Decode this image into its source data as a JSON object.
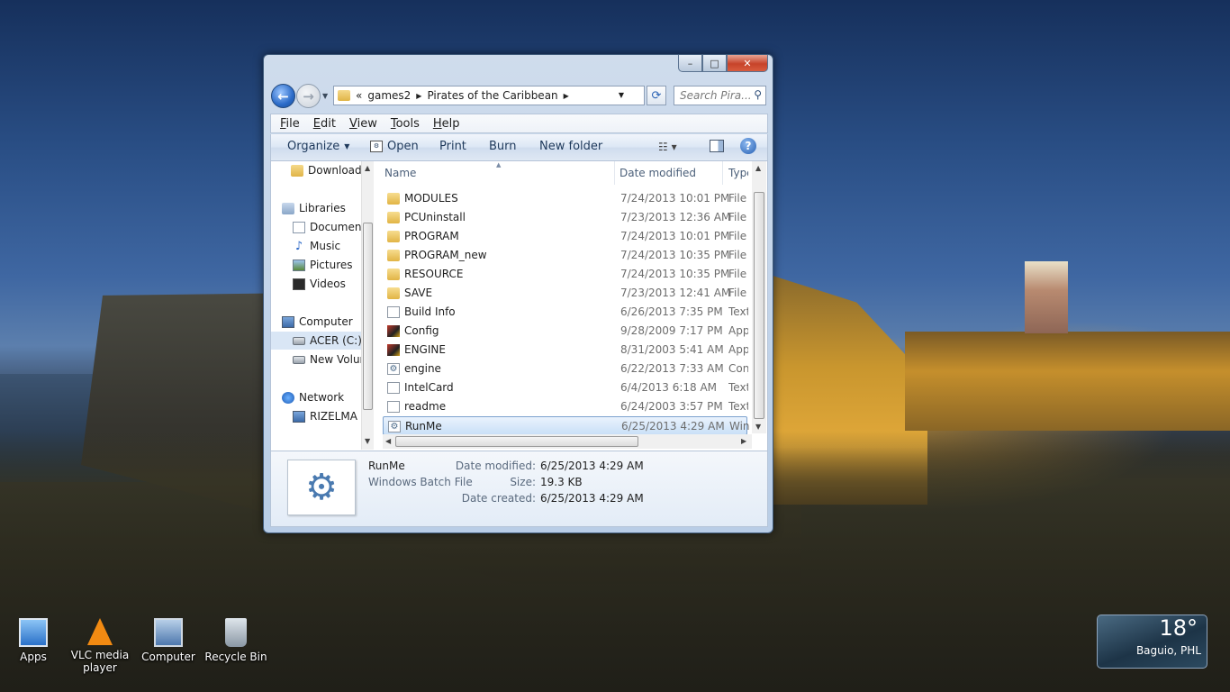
{
  "window": {
    "caption_buttons": {
      "minimize": "–",
      "maximize": "□",
      "close": "✕"
    },
    "address": {
      "overflow": "«",
      "crumbs": [
        "games2",
        "Pirates of the Caribbean"
      ],
      "refresh_icon": "⟳"
    },
    "search": {
      "placeholder": "Search Pira..."
    },
    "menu": [
      "File",
      "Edit",
      "View",
      "Tools",
      "Help"
    ],
    "commands": {
      "organize": "Organize",
      "open": "Open",
      "print": "Print",
      "burn": "Burn",
      "new_folder": "New folder",
      "help": "?"
    },
    "nav_pane": [
      {
        "label": "Downloads",
        "icon": "folder-icon"
      },
      {
        "label": "Libraries",
        "icon": "library-icon"
      },
      {
        "label": "Documents",
        "icon": "documents-icon"
      },
      {
        "label": "Music",
        "icon": "music-icon"
      },
      {
        "label": "Pictures",
        "icon": "pictures-icon"
      },
      {
        "label": "Videos",
        "icon": "videos-icon"
      },
      {
        "label": "Computer",
        "icon": "computer-icon"
      },
      {
        "label": "ACER (C:)",
        "icon": "drive-icon"
      },
      {
        "label": "New Volume",
        "icon": "drive-icon"
      },
      {
        "label": "Network",
        "icon": "network-icon"
      },
      {
        "label": "RIZELMA",
        "icon": "computer-icon"
      }
    ],
    "columns": {
      "name": "Name",
      "date": "Date modified",
      "type": "Type"
    },
    "files": [
      {
        "name": "MODULES",
        "date": "7/24/2013 10:01 PM",
        "type": "File",
        "icon": "folder-icon"
      },
      {
        "name": "PCUninstall",
        "date": "7/23/2013 12:36 AM",
        "type": "File",
        "icon": "folder-icon"
      },
      {
        "name": "PROGRAM",
        "date": "7/24/2013 10:01 PM",
        "type": "File",
        "icon": "folder-icon"
      },
      {
        "name": "PROGRAM_new",
        "date": "7/24/2013 10:35 PM",
        "type": "File",
        "icon": "folder-icon"
      },
      {
        "name": "RESOURCE",
        "date": "7/24/2013 10:35 PM",
        "type": "File",
        "icon": "folder-icon"
      },
      {
        "name": "SAVE",
        "date": "7/23/2013 12:41 AM",
        "type": "File",
        "icon": "folder-icon"
      },
      {
        "name": "Build Info",
        "date": "6/26/2013 7:35 PM",
        "type": "Text",
        "icon": "text-file-icon"
      },
      {
        "name": "Config",
        "date": "9/28/2009 7:17 PM",
        "type": "App",
        "icon": "app-icon"
      },
      {
        "name": "ENGINE",
        "date": "8/31/2003 5:41 AM",
        "type": "App",
        "icon": "app-icon"
      },
      {
        "name": "engine",
        "date": "6/22/2013 7:33 AM",
        "type": "Con",
        "icon": "config-file-icon"
      },
      {
        "name": "IntelCard",
        "date": "6/4/2013 6:18 AM",
        "type": "Text",
        "icon": "text-file-icon"
      },
      {
        "name": "readme",
        "date": "6/24/2003 3:57 PM",
        "type": "Text",
        "icon": "text-file-icon"
      },
      {
        "name": "RunMe",
        "date": "6/25/2013 4:29 AM",
        "type": "Win",
        "icon": "batch-file-icon",
        "selected": true
      }
    ],
    "details": {
      "name": "RunMe",
      "kind": "Windows Batch File",
      "modified_label": "Date modified:",
      "modified_value": "6/25/2013 4:29 AM",
      "size_label": "Size:",
      "size_value": "19.3 KB",
      "created_label": "Date created:",
      "created_value": "6/25/2013 4:29 AM"
    }
  },
  "desktop_icons": [
    {
      "label": "Apps",
      "icon": "apps-icon"
    },
    {
      "label": "VLC media player",
      "icon": "vlc-icon"
    },
    {
      "label": "Computer",
      "icon": "computer-icon"
    },
    {
      "label": "Recycle Bin",
      "icon": "recycle-bin-icon"
    }
  ],
  "weather": {
    "temp": "18°",
    "location": "Baguio, PHL"
  }
}
